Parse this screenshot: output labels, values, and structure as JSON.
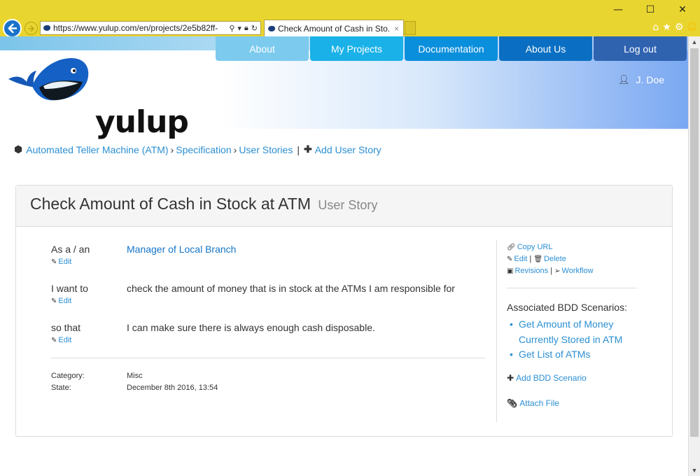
{
  "browser": {
    "url": "https://www.yulup.com/en/projects/2e5b82ff-",
    "tab_title": "Check Amount of Cash in Sto...",
    "tab_close": "×",
    "window_controls": {
      "minimize": "—",
      "maximize": "☐",
      "close": "✕"
    },
    "theme_color": "#e9d52f"
  },
  "site": {
    "logo_text": "yulup",
    "menu": [
      {
        "label": "About"
      },
      {
        "label": "My Projects"
      },
      {
        "label": "Documentation"
      },
      {
        "label": "About Us"
      },
      {
        "label": "Log out"
      }
    ],
    "user_name": "J. Doe"
  },
  "breadcrumb": {
    "project": "Automated Teller Machine (ATM)",
    "section": "Specification",
    "subsection": "User Stories",
    "action": "Add User Story"
  },
  "story": {
    "title": "Check Amount of Cash in Stock at ATM",
    "type": "User Story",
    "rows": [
      {
        "label": "As a / an",
        "edit": "Edit",
        "value": "Manager of Local Branch"
      },
      {
        "label": "I want to",
        "edit": "Edit",
        "value": "check the amount of money that is in stock at the ATMs I am responsible for"
      },
      {
        "label": "so that",
        "edit": "Edit",
        "value": "I can make sure there is always enough cash disposable."
      }
    ],
    "meta": {
      "category_label": "Category:",
      "category_value": "Misc",
      "state_label": "State:",
      "state_value": "December 8th 2016, 13:54"
    }
  },
  "sidebar": {
    "copy_url": "Copy URL",
    "edit": "Edit",
    "delete": "Delete",
    "revisions": "Revisions",
    "workflow": "Workflow",
    "bdd_heading": "Associated BDD Scenarios:",
    "bdd_scenarios": [
      "Get Amount of Money Currently Stored in ATM",
      "Get List of ATMs"
    ],
    "add_bdd": "Add BDD Scenario",
    "attach_file": "Attach File"
  }
}
